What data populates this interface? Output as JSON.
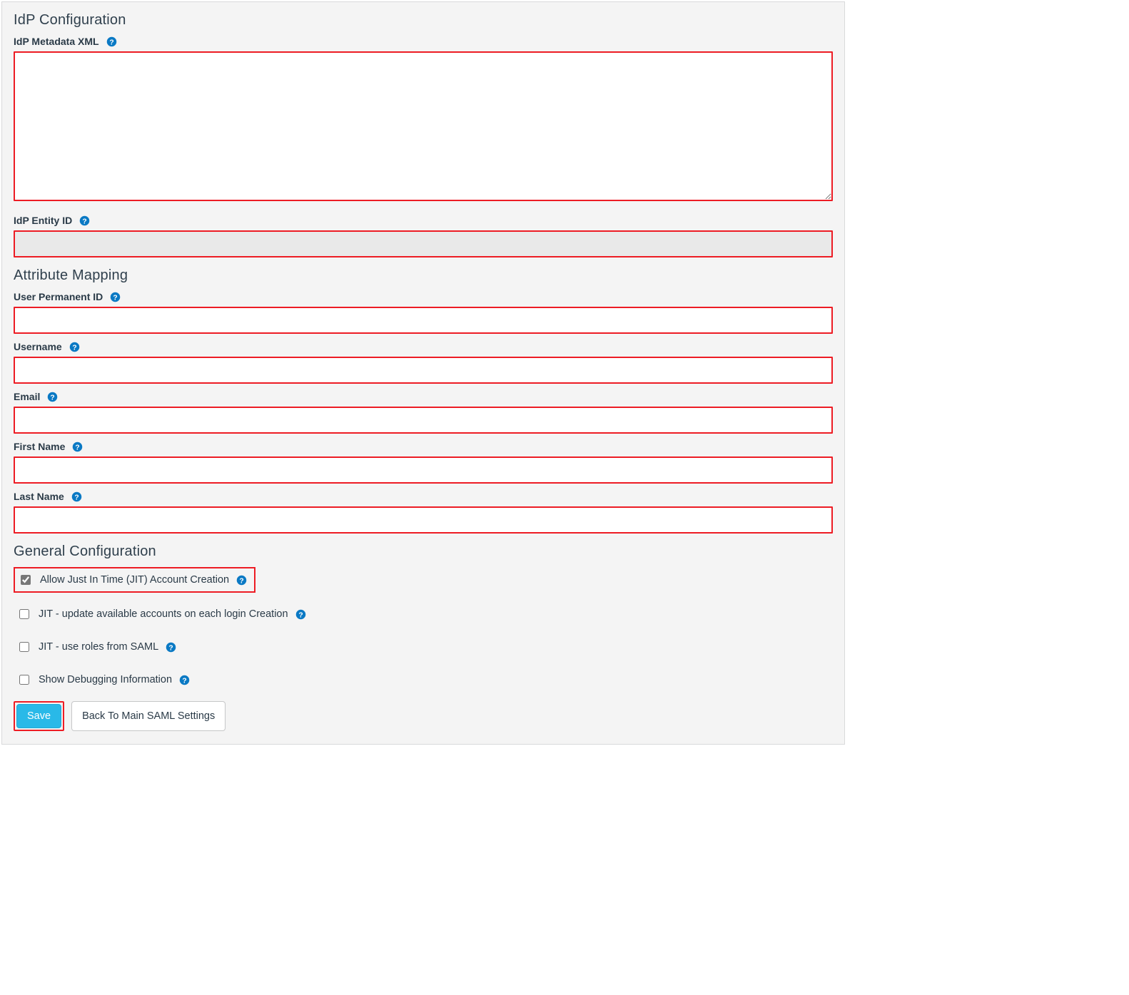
{
  "sections": {
    "idp": {
      "title": "IdP Configuration"
    },
    "attr": {
      "title": "Attribute Mapping"
    },
    "general": {
      "title": "General Configuration"
    }
  },
  "fields": {
    "idp_metadata_xml": {
      "label": "IdP Metadata XML",
      "value": ""
    },
    "idp_entity_id": {
      "label": "IdP Entity ID",
      "value": ""
    },
    "user_permanent_id": {
      "label": "User Permanent ID",
      "value": ""
    },
    "username": {
      "label": "Username",
      "value": ""
    },
    "email": {
      "label": "Email",
      "value": ""
    },
    "first_name": {
      "label": "First Name",
      "value": ""
    },
    "last_name": {
      "label": "Last Name",
      "value": ""
    }
  },
  "checkboxes": {
    "jit_create": {
      "label": "Allow Just In Time (JIT) Account Creation",
      "checked": true
    },
    "jit_update": {
      "label": "JIT - update available accounts on each login Creation",
      "checked": false
    },
    "jit_roles": {
      "label": "JIT - use roles from SAML",
      "checked": false
    },
    "debug": {
      "label": "Show Debugging Information",
      "checked": false
    }
  },
  "buttons": {
    "save": "Save",
    "back": "Back To Main SAML Settings"
  }
}
